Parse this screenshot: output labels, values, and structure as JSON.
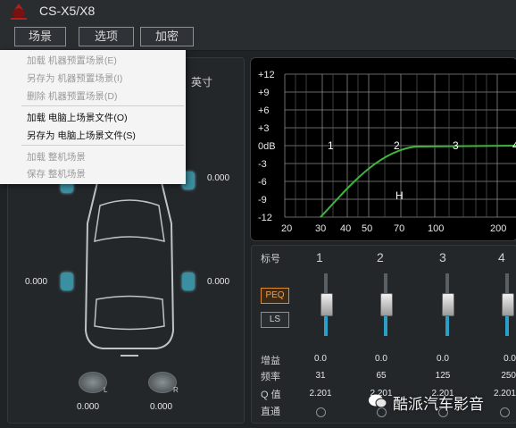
{
  "window": {
    "title": "CS-X5/X8"
  },
  "menu": [
    {
      "label": "场景"
    },
    {
      "label": "选项"
    },
    {
      "label": "加密"
    }
  ],
  "dropdown": [
    {
      "label": "加载 机器预置场景(E)",
      "enabled": false
    },
    {
      "label": "另存为 机器预置场景(I)",
      "enabled": false
    },
    {
      "label": "删除 机器预置场景(D)",
      "enabled": false
    },
    {
      "label": "加载 电脑上场景文件(O)",
      "enabled": true
    },
    {
      "label": "另存为 电脑上场景文件(S)",
      "enabled": true
    },
    {
      "label": "加载 整机场景",
      "enabled": false
    },
    {
      "label": "保存 整机场景",
      "enabled": false
    }
  ],
  "car": {
    "unit_label": "英寸",
    "front_right_value": "0.000",
    "rear_left_value": "0.000",
    "rear_right_value": "0.000",
    "sub_left_value": "0.000",
    "sub_right_value": "0.000",
    "sub_left_label": "L",
    "sub_right_label": "R"
  },
  "graph": {
    "y_ticks": [
      "+12",
      "+9",
      "+6",
      "+3",
      "0dB",
      "-3",
      "-6",
      "-9",
      "-12"
    ],
    "x_ticks": [
      "20",
      "30",
      "40",
      "50",
      "70",
      "100",
      "200"
    ],
    "markers": [
      "1",
      "2",
      "3",
      "4"
    ],
    "h_marker": "H",
    "curve_color": "#3fb53f"
  },
  "eq": {
    "row_labels": {
      "label": "标号",
      "gain": "增益",
      "freq": "频率",
      "q": "Q 值",
      "bypass": "直通"
    },
    "peq_label": "PEQ",
    "ls_label": "LS",
    "columns": [
      {
        "num": "1",
        "gain": "0.0",
        "freq": "31",
        "q": "2.201"
      },
      {
        "num": "2",
        "gain": "0.0",
        "freq": "65",
        "q": "2.201"
      },
      {
        "num": "3",
        "gain": "0.0",
        "freq": "125",
        "q": "2.201"
      },
      {
        "num": "4",
        "gain": "0.0",
        "freq": "250",
        "q": "2.201"
      }
    ]
  },
  "watermark": {
    "text": "酷派汽车影音"
  }
}
